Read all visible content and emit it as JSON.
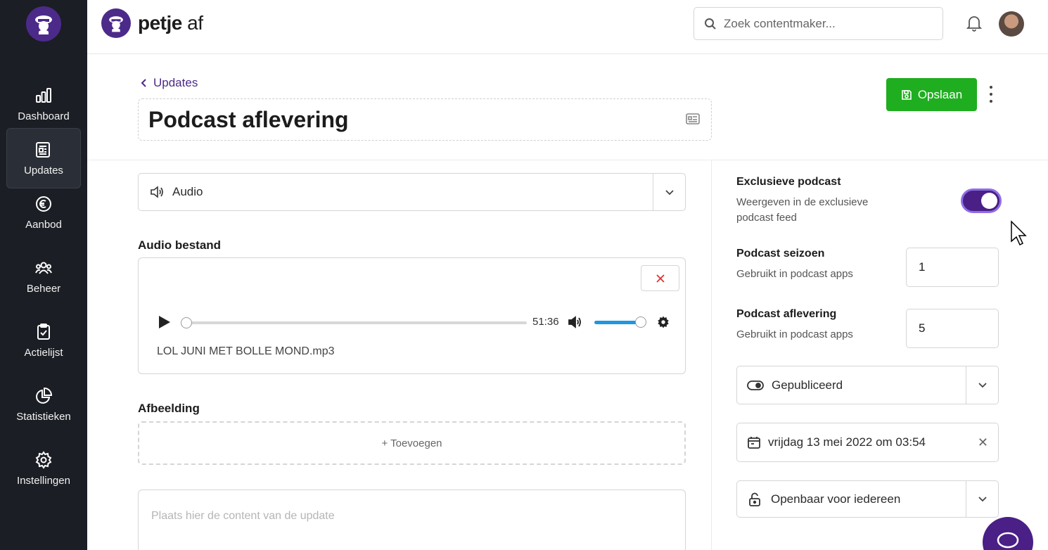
{
  "brand": {
    "name_bold": "petje",
    "name_light": " af"
  },
  "sidebar": {
    "items": [
      {
        "label": "Dashboard",
        "icon": "bar-chart-icon"
      },
      {
        "label": "Updates",
        "icon": "newspaper-icon",
        "active": true
      },
      {
        "label": "Aanbod",
        "icon": "euro-icon"
      },
      {
        "label": "Beheer",
        "icon": "users-icon"
      },
      {
        "label": "Actielijst",
        "icon": "clipboard-check-icon"
      },
      {
        "label": "Statistieken",
        "icon": "pie-chart-icon"
      },
      {
        "label": "Instellingen",
        "icon": "gear-icon"
      }
    ]
  },
  "topbar": {
    "search_placeholder": "Zoek contentmaker..."
  },
  "header": {
    "back_label": "Updates",
    "title": "Podcast aflevering",
    "save_label": "Opslaan"
  },
  "main": {
    "type_select": "Audio",
    "audio_label": "Audio bestand",
    "audio": {
      "duration": "51:36",
      "filename": "LOL JUNI MET BOLLE MOND.mp3",
      "progress": 0,
      "volume": 1.0
    },
    "image_label": "Afbeelding",
    "add_label": "+ Toevoegen",
    "content_placeholder": "Plaats hier de content van de update"
  },
  "settings": {
    "exclusive": {
      "title": "Exclusieve podcast",
      "subtitle_line1": "Weergeven in de exclusieve",
      "subtitle_line2": "podcast feed",
      "enabled": true
    },
    "season": {
      "title": "Podcast seizoen",
      "subtitle": "Gebruikt in podcast apps",
      "value": "1"
    },
    "episode": {
      "title": "Podcast aflevering",
      "subtitle": "Gebruikt in podcast apps",
      "value": "5"
    },
    "status": "Gepubliceerd",
    "date": "vrijdag 13 mei 2022 om 03:54",
    "visibility": "Openbaar voor iedereen"
  },
  "colors": {
    "brand_purple": "#4c2a8a",
    "save_green": "#1fae1f",
    "sidebar_bg": "#1b1e24",
    "volume_blue": "#2096e0"
  }
}
